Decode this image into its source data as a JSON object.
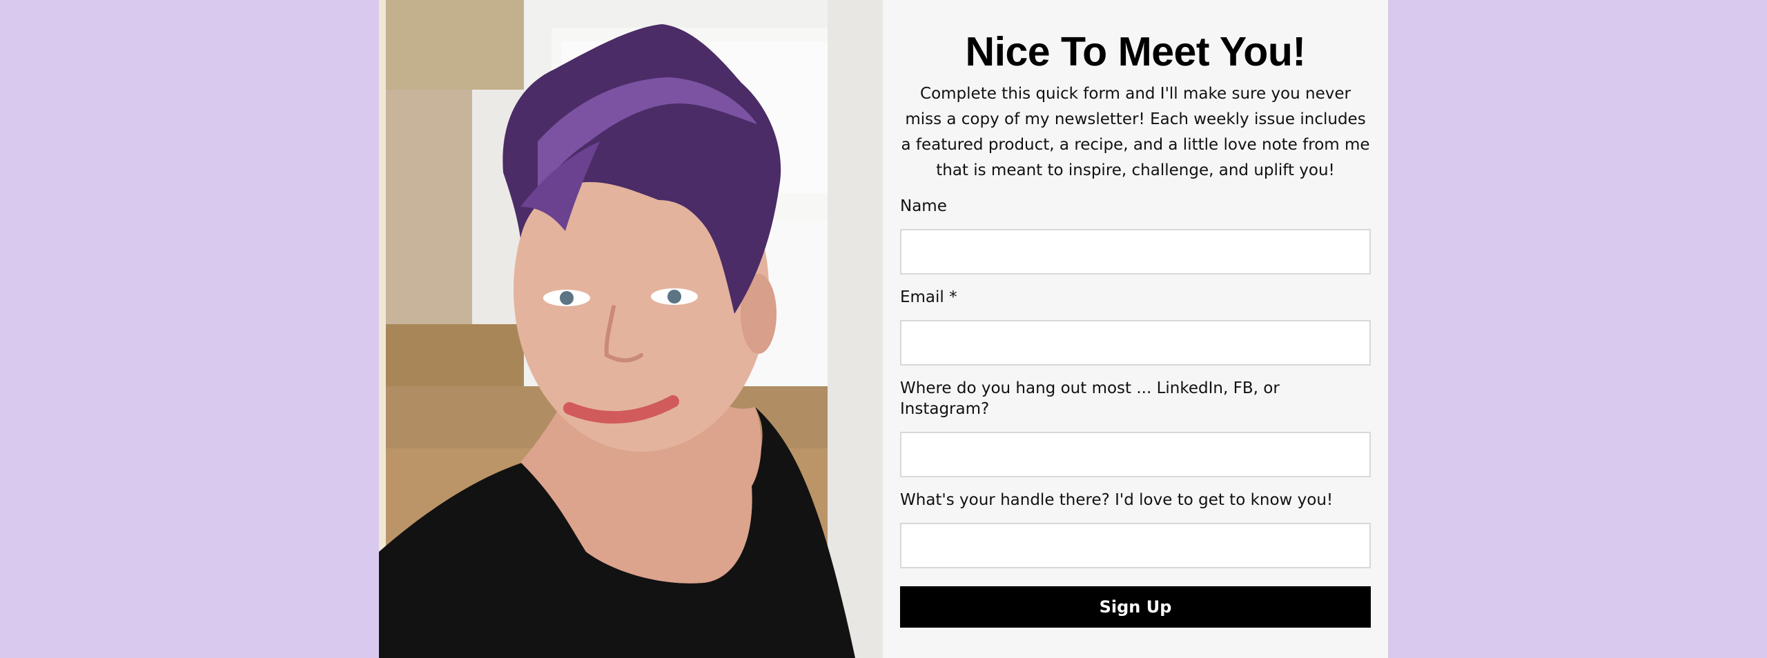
{
  "form": {
    "title": "Nice To Meet You!",
    "intro": "Complete this quick form and I'll make sure you never miss a copy of my newsletter! Each weekly issue includes a featured product, a recipe, and a little love note from me that is meant to inspire, challenge, and uplift you!",
    "fields": [
      {
        "label": "Name",
        "value": "",
        "placeholder": ""
      },
      {
        "label": "Email *",
        "value": "",
        "placeholder": ""
      },
      {
        "label": "Where do you hang out most ... LinkedIn, FB, or Instagram?",
        "value": "",
        "placeholder": ""
      },
      {
        "label": "What's your handle there? I'd love to get to know you!",
        "value": "",
        "placeholder": ""
      }
    ],
    "submit_label": "Sign Up"
  },
  "colors": {
    "page_background": "#d9c9ee",
    "form_background": "#f6f6f6",
    "button_background": "#000000",
    "button_text": "#ffffff"
  }
}
